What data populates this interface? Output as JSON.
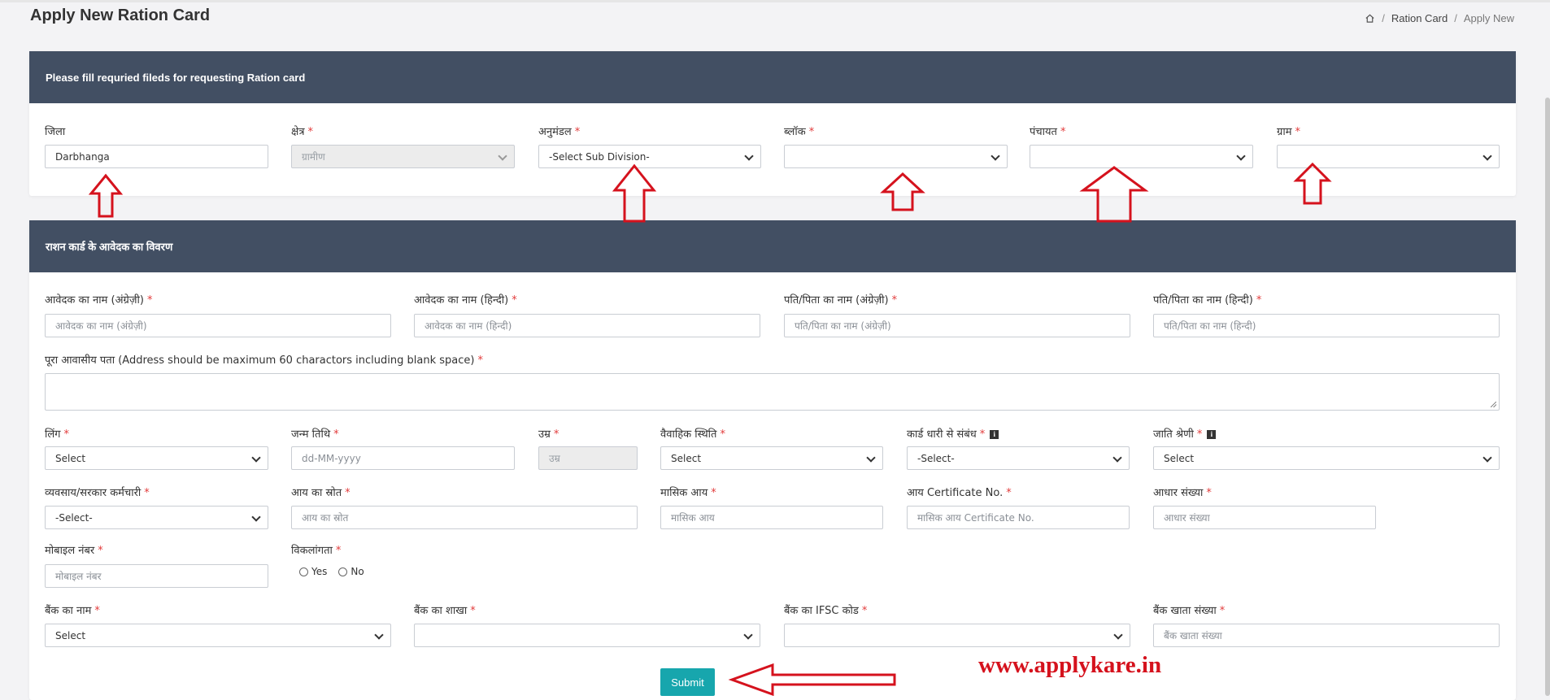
{
  "page": {
    "title": "Apply New Ration Card",
    "breadcrumb": [
      "Ration Card",
      "Apply New"
    ],
    "breadcrumb_sep": "/"
  },
  "location_card": {
    "header": "Please fill requried fileds for requesting Ration card",
    "fields": [
      {
        "label": "जिला",
        "required": false,
        "value": "Darbhanga",
        "type": "input"
      },
      {
        "label": "क्षेत्र",
        "required": true,
        "value": "ग्रामीण",
        "type": "select",
        "disabled": true
      },
      {
        "label": "अनुमंडल",
        "required": true,
        "value": "-Select Sub Division-",
        "type": "select"
      },
      {
        "label": "ब्लॉक",
        "required": true,
        "value": "",
        "type": "select"
      },
      {
        "label": "पंचायत",
        "required": true,
        "value": "",
        "type": "select"
      },
      {
        "label": "ग्राम",
        "required": true,
        "value": "",
        "type": "select"
      }
    ]
  },
  "applicant_card": {
    "header": "राशन कार्ड के आवेदक का विवरण",
    "name_en": {
      "label": "आवेदक का नाम (अंग्रेज़ी)",
      "placeholder": "आवेदक का नाम (अंग्रेज़ी)"
    },
    "name_hi": {
      "label": "आवेदक का नाम (हिन्दी)",
      "placeholder": "आवेदक का नाम (हिन्दी)"
    },
    "father_en": {
      "label": "पति/पिता का नाम (अंग्रेज़ी)",
      "placeholder": "पति/पिता का नाम (अंग्रेज़ी)"
    },
    "father_hi": {
      "label": "पति/पिता का नाम (हिन्दी)",
      "placeholder": "पति/पिता का नाम (हिन्दी)"
    },
    "address": {
      "label": "पूरा आवासीय पता (Address should be maximum 60 charactors including blank space)",
      "value": ""
    },
    "gender": {
      "label": "लिंग",
      "value": "Select"
    },
    "dob": {
      "label": "जन्म तिथि",
      "placeholder": "dd-MM-yyyy"
    },
    "age": {
      "label": "उम्र",
      "placeholder": "उम्र"
    },
    "marital": {
      "label": "वैवाहिक स्थिति",
      "value": "Select"
    },
    "relation": {
      "label": "कार्ड धारी से संबंध",
      "value": "-Select-"
    },
    "caste": {
      "label": "जाति श्रेणी",
      "value": "Select"
    },
    "occupation": {
      "label": "व्यवसाय/सरकार कर्मचारी",
      "value": "-Select-"
    },
    "income_source": {
      "label": "आय का स्रोत",
      "placeholder": "आय का स्रोत"
    },
    "monthly_income": {
      "label": "मासिक आय",
      "placeholder": "मासिक आय"
    },
    "income_cert": {
      "label": "आय Certificate No.",
      "placeholder": "मासिक आय Certificate No."
    },
    "aadhar": {
      "label": "आधार संख्या",
      "placeholder": "आधार संख्या"
    },
    "mobile": {
      "label": "मोबाइल नंबर",
      "placeholder": "मोबाइल नंबर"
    },
    "disability": {
      "label": "विकलांगता",
      "options": [
        "Yes",
        "No"
      ]
    },
    "bank_name": {
      "label": "बैंक का नाम",
      "value": "Select"
    },
    "bank_branch": {
      "label": "बैंक का शाखा",
      "value": ""
    },
    "bank_ifsc": {
      "label": "बैंक का IFSC कोड",
      "value": ""
    },
    "bank_account": {
      "label": "बैंक खाता संख्या",
      "placeholder": "बैंक खाता संख्या"
    }
  },
  "submit_label": "Submit",
  "watermark": "www.applykare.in",
  "required_mark": "*",
  "info_icon_glyph": "i",
  "colors": {
    "header_bg": "#424f63",
    "submit_bg": "#17a6ad",
    "annotation_red": "#d5121d"
  }
}
